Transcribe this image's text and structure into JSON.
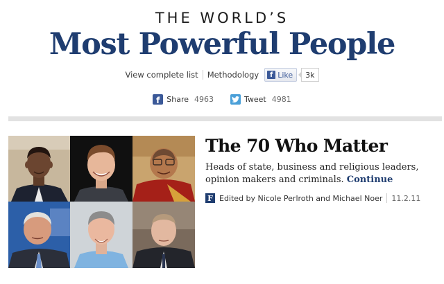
{
  "header": {
    "kicker": "THE WORLD’S",
    "title": "Most Powerful People"
  },
  "links": {
    "view_list": "View complete list",
    "methodology": "Methodology",
    "like_label": "Like",
    "like_count": "3k"
  },
  "share": {
    "facebook_label": "Share",
    "facebook_count": "4963",
    "twitter_label": "Tweet",
    "twitter_count": "4981"
  },
  "feature": {
    "headline": "The 70 Who Matter",
    "dek": "Heads of state, business and religious leaders, opinion makers and criminals.",
    "continue_label": "Continue",
    "byline": "Edited by Nicole Perlroth and Michael Noer",
    "date": "11.2.11"
  },
  "colors": {
    "title_blue": "#1f3d70",
    "facebook_blue": "#3b5998",
    "twitter_blue": "#4a9fd8"
  }
}
